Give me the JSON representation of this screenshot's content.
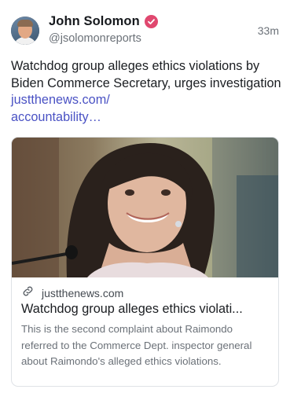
{
  "author": {
    "name": "John Solomon",
    "handle": "@jsolomonreports",
    "verified_icon": "verified-badge",
    "verified_color": "#e0486f"
  },
  "timestamp": "33m",
  "post": {
    "text": "Watchdog group alleges ethics violations by Biden Commerce Secretary, urges investigation",
    "link_text": "justthenews.com/\naccountability…",
    "link_color": "#4a52c4"
  },
  "link_card": {
    "link_icon": "link-icon",
    "domain": "justthenews.com",
    "title": "Watchdog group alleges ethics violati...",
    "description": "This is the second complaint about Raimondo referred to the Commerce Dept. inspector general about Raimondo's alleged ethics violations."
  }
}
